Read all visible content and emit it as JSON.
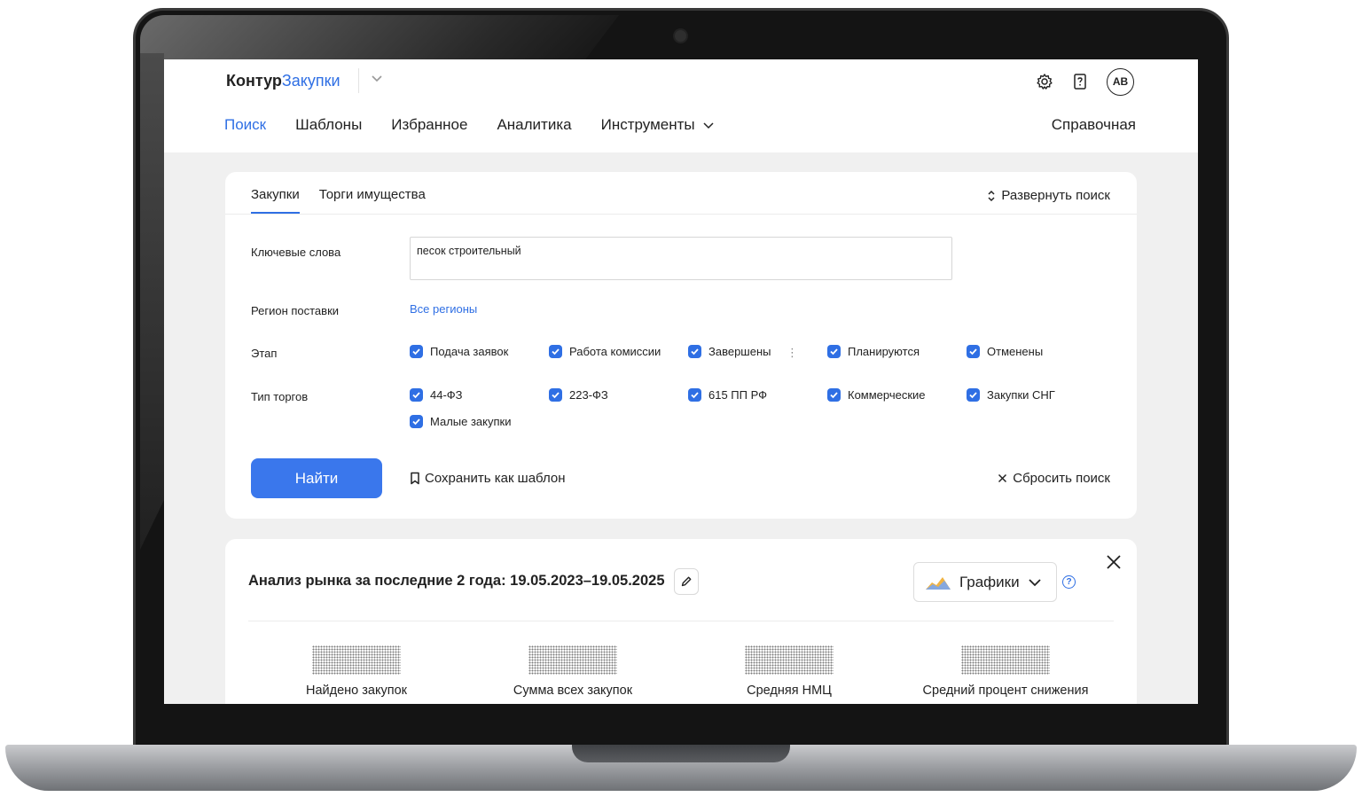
{
  "header": {
    "logo_part1": "Контур",
    "logo_part2": "Закупки",
    "avatar_initials": "АВ"
  },
  "nav": {
    "items": [
      "Поиск",
      "Шаблоны",
      "Избранное",
      "Аналитика",
      "Инструменты"
    ],
    "active": "Поиск",
    "help": "Справочная"
  },
  "search": {
    "tabs": [
      "Закупки",
      "Торги имущества"
    ],
    "active_tab": "Закупки",
    "expand_label": "Развернуть поиск",
    "keywords_label": "Ключевые слова",
    "keywords_value": "песок строительный",
    "region_label": "Регион поставки",
    "region_value": "Все регионы",
    "stage_label": "Этап",
    "stages": [
      "Подача заявок",
      "Работа комиссии",
      "Завершены",
      "Планируются",
      "Отменены"
    ],
    "type_label": "Тип торгов",
    "types": [
      "44-ФЗ",
      "223-ФЗ",
      "615 ПП РФ",
      "Коммерческие",
      "Закупки СНГ",
      "Малые закупки"
    ],
    "find_button": "Найти",
    "save_template": "Сохранить как шаблон",
    "reset": "Сбросить поиск"
  },
  "analysis": {
    "title": "Анализ рынка за последние 2 года: 19.05.2023–19.05.2025",
    "charts_button": "Графики",
    "metrics": [
      "Найдено закупок",
      "Сумма всех закупок",
      "Средняя НМЦ",
      "Средний процент снижения"
    ]
  },
  "colors": {
    "accent": "#2f6fe4",
    "button": "#3a77ec"
  }
}
